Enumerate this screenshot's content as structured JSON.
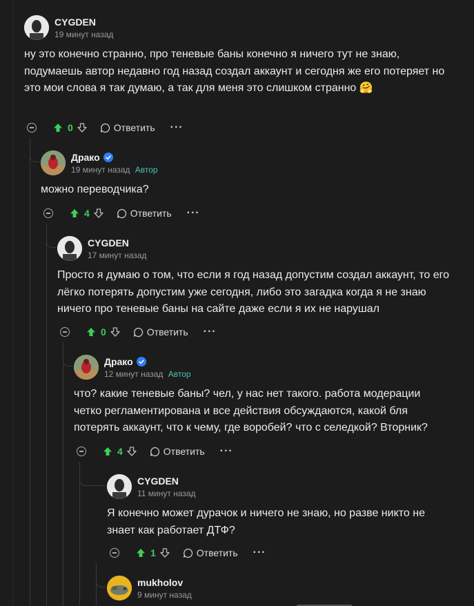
{
  "comments": [
    {
      "author": "CYGDEN",
      "time": "19 минут назад",
      "author_badge": "",
      "text": "ну это конечно странно, про теневые баны конечно я ничего тут не знаю, подумаешь автор недавно год назад создал аккаунт и сегодня же его потеряет но это мои слова я так думаю, а так для меня это слишком странно",
      "emoji": "🤗",
      "score": "0",
      "reply_label": "Ответить"
    },
    {
      "author": "Драко",
      "time": "19 минут назад",
      "author_badge": "Автор",
      "text": "можно переводчика?",
      "score": "4",
      "reply_label": "Ответить"
    },
    {
      "author": "CYGDEN",
      "time": "17 минут назад",
      "author_badge": "",
      "text": "Просто я думаю о том, что если я год назад допустим создал аккаунт, то его лёгко потерять допустим уже сегодня, либо это загадка когда я не знаю ничего про теневые баны на сайте даже если я их не нарушал",
      "score": "0",
      "reply_label": "Ответить"
    },
    {
      "author": "Драко",
      "time": "12 минут назад",
      "author_badge": "Автор",
      "text": "что? какие теневые баны? чел, у нас нет такого. работа модерации четко регламентирована и все действия обсуждаются, какой бля потерять аккаунт, что к чему, где воробей? что с селедкой? Вторник?",
      "score": "4",
      "reply_label": "Ответить"
    },
    {
      "author": "CYGDEN",
      "time": "11 минут назад",
      "author_badge": "",
      "text": "Я конечно может дурачок и ничего не знаю, но разве никто не знает как работает ДТФ?",
      "score": "1",
      "reply_label": "Ответить"
    },
    {
      "author": "mukholov",
      "time": "9 минут назад",
      "author_badge": ""
    }
  ],
  "colors": {
    "background": "#1c1c1c",
    "score_green": "#3ecf5a",
    "author_badge": "#4fc3b4",
    "verified_blue": "#2f7cf6"
  },
  "icons": [
    "collapse-icon",
    "upvote-icon",
    "downvote-icon",
    "reply-bubble-icon",
    "more-dots-icon",
    "verified-icon"
  ]
}
